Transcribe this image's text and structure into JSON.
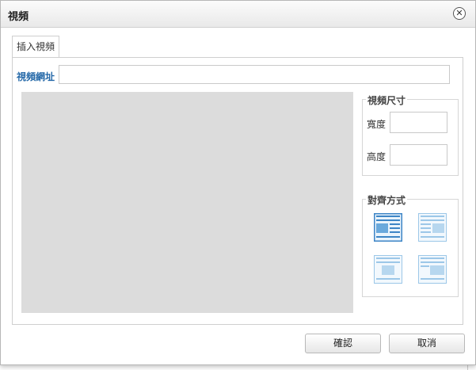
{
  "dialog": {
    "title": "視頻",
    "close_glyph": "✕",
    "tab": "插入視頻",
    "url_label": "視頻網址",
    "url_value": "",
    "size_legend": "視頻尺寸",
    "width_label": "寬度",
    "width_value": "",
    "height_label": "高度",
    "height_value": "",
    "align_legend": "對齊方式",
    "align_options": [
      "align-left",
      "align-right",
      "align-center-left",
      "align-center-right"
    ],
    "selected_align": 0,
    "confirm_label": "確認",
    "cancel_label": "取消"
  },
  "colors": {
    "accent": "#2468a8",
    "preview_bg": "#dcdcdc",
    "icon_selected": "#3d85c6",
    "icon_normal": "#9cc7e8"
  }
}
